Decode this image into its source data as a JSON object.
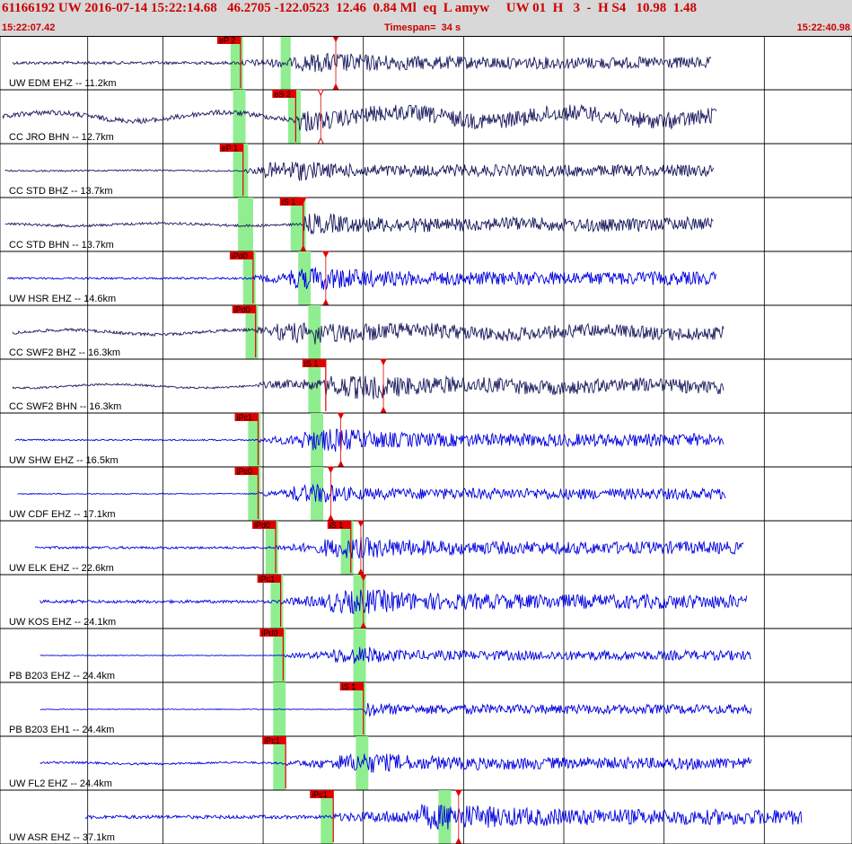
{
  "header": {
    "title": "61166192 UW 2016-07-14 15:22:14.68   46.2705 -122.0523  12.46  0.84 Ml  eq  L amyw     UW 01  H   3  -  H S4   10.98  1.48",
    "time_start": "15:22:07.42",
    "timespan": "Timespan=  34 s",
    "time_end": "15:22:40.98"
  },
  "colors": {
    "header_bg": "#d8d8d8",
    "header_text": "#cc0000",
    "trace_blue": "#0000e0",
    "trace_navy": "#1a1a5e",
    "pick_red": "#e00000",
    "window_green": "#90ee90",
    "gridline": "#000000"
  },
  "chart_data": {
    "type": "seismogram",
    "x_range_s": [
      0,
      34
    ],
    "gridline_seconds": [
      0,
      3.5,
      6.5,
      10.5,
      14.5,
      18.5,
      22.5,
      26.5,
      30.5,
      34
    ],
    "traces": [
      {
        "label": "UW EDM EHZ -- 11.2km",
        "color": "navy_blue",
        "amp": 0.35,
        "noise": 0.06,
        "start": 0.5,
        "end": 28.4,
        "arrival": 9.6,
        "peak": 13.5,
        "decay": 7,
        "wobble": 0,
        "green": [
          9.2,
          9.7,
          11.2,
          11.6
        ],
        "picks": [
          {
            "label": "eP 2",
            "t": 9.6
          }
        ],
        "markers": [
          {
            "t": 13.4,
            "shape": "tri"
          }
        ]
      },
      {
        "label": "CC JRO BHN -- 12.7km",
        "color": "navy",
        "amp": 0.45,
        "noise": 0.1,
        "start": 0.1,
        "end": 28.6,
        "arrival": 11.8,
        "peak": 11.9,
        "decay": 2,
        "wobble": 0.28,
        "green": [
          9.3,
          9.8,
          11.5,
          12.0
        ],
        "picks": [
          {
            "label": "eS 2",
            "t": 11.8
          }
        ],
        "markers": [
          {
            "t": 12.8,
            "shape": "tri-open"
          }
        ]
      },
      {
        "label": "CC STD BHZ -- 13.7km",
        "color": "navy",
        "amp": 0.4,
        "noise": 0.03,
        "start": 0.2,
        "end": 28.5,
        "arrival": 9.7,
        "peak": 12.0,
        "decay": 3,
        "wobble": 0.02,
        "green": [
          9.3,
          9.9
        ],
        "picks": [
          {
            "label": "eP 1",
            "t": 9.7
          }
        ],
        "markers": []
      },
      {
        "label": "CC STD BHN -- 13.7km",
        "color": "navy",
        "amp": 0.42,
        "noise": 0.05,
        "start": 0.2,
        "end": 28.5,
        "arrival": 12.1,
        "peak": 12.2,
        "decay": 6,
        "wobble": 0.08,
        "green": [
          9.5,
          10.1,
          11.6,
          12.2
        ],
        "picks": [
          {
            "label": "iS 1",
            "t": 12.1
          }
        ],
        "markers": [
          {
            "t": 12.1,
            "shape": "tri-b"
          }
        ]
      },
      {
        "label": "UW HSR EHZ -- 14.6km",
        "color": "blue",
        "amp": 0.45,
        "noise": 0.04,
        "start": 0.3,
        "end": 28.6,
        "arrival": 10.1,
        "peak": 13.0,
        "decay": 5,
        "wobble": 0,
        "green": [
          9.7,
          10.2,
          11.9,
          12.4
        ],
        "picks": [
          {
            "label": "iPd0",
            "t": 10.1
          }
        ],
        "markers": [
          {
            "t": 13.0,
            "shape": "tri"
          }
        ]
      },
      {
        "label": "CC SWF2 BHZ -- 16.3km",
        "color": "navy",
        "amp": 0.4,
        "noise": 0.06,
        "start": 0.5,
        "end": 28.9,
        "arrival": 10.2,
        "peak": 12.5,
        "decay": 9,
        "wobble": 0.15,
        "green": [
          9.8,
          10.3,
          12.3,
          12.8
        ],
        "picks": [
          {
            "label": "iPd0",
            "t": 10.2
          }
        ],
        "markers": []
      },
      {
        "label": "CC SWF2 BHN -- 16.3km",
        "color": "navy",
        "amp": 0.45,
        "noise": 0.04,
        "start": 0.5,
        "end": 28.9,
        "arrival": 10.3,
        "peak": 14.5,
        "decay": 9,
        "wobble": 0.12,
        "green": [
          12.3,
          12.8
        ],
        "picks": [
          {
            "label": "iS 1",
            "t": 13.0
          }
        ],
        "markers": [
          {
            "t": 15.3,
            "shape": "tri"
          }
        ]
      },
      {
        "label": "UW SHW EHZ -- 16.5km",
        "color": "blue",
        "amp": 0.45,
        "noise": 0.03,
        "start": 0.6,
        "end": 28.9,
        "arrival": 10.3,
        "peak": 13.5,
        "decay": 5,
        "wobble": 0,
        "green": [
          9.9,
          10.4,
          12.4,
          12.9
        ],
        "picks": [
          {
            "label": "iPc1",
            "t": 10.3
          }
        ],
        "markers": [
          {
            "t": 13.6,
            "shape": "tri"
          }
        ]
      },
      {
        "label": "UW CDF EHZ -- 17.1km",
        "color": "blue",
        "amp": 0.4,
        "noise": 0.02,
        "start": 0.7,
        "end": 29.0,
        "arrival": 10.3,
        "peak": 13.1,
        "decay": 1.2,
        "wobble": 0,
        "green": [
          9.9,
          10.4,
          12.4,
          12.9
        ],
        "picks": [
          {
            "label": "iPc0",
            "t": 10.3
          }
        ],
        "markers": [
          {
            "t": 13.2,
            "shape": "tri"
          }
        ]
      },
      {
        "label": "UW ELK EHZ -- 22.6km",
        "color": "blue",
        "amp": 0.4,
        "noise": 0.05,
        "start": 1.4,
        "end": 29.7,
        "arrival": 11.0,
        "peak": 14.4,
        "decay": 6,
        "wobble": 0,
        "green": [
          10.6,
          11.1,
          13.6,
          14.1
        ],
        "picks": [
          {
            "label": "iPd0",
            "t": 11.0
          },
          {
            "label": "iS 1",
            "t": 14.0
          }
        ],
        "markers": [
          {
            "t": 14.4,
            "shape": "tri"
          }
        ]
      },
      {
        "label": "UW KOS EHZ -- 24.1km",
        "color": "blue",
        "amp": 0.45,
        "noise": 0.06,
        "start": 1.6,
        "end": 29.8,
        "arrival": 11.2,
        "peak": 14.6,
        "decay": 6,
        "wobble": 0,
        "green": [
          10.8,
          11.3,
          14.1,
          14.6
        ],
        "picks": [
          {
            "label": "iPc1",
            "t": 11.2
          }
        ],
        "markers": [
          {
            "t": 14.5,
            "shape": "tri"
          }
        ]
      },
      {
        "label": "PB B203 EHZ -- 24.4km",
        "color": "blue",
        "amp": 0.35,
        "noise": 0.015,
        "start": 1.6,
        "end": 30.0,
        "arrival": 11.3,
        "peak": 14.7,
        "decay": 2,
        "wobble": 0,
        "green": [
          10.9,
          11.4,
          14.1,
          14.6
        ],
        "picks": [
          {
            "label": "iPd0",
            "t": 11.3
          }
        ],
        "markers": []
      },
      {
        "label": "PB B203 EH1 -- 24.4km",
        "color": "blue",
        "amp": 0.35,
        "noise": 0.015,
        "start": 1.6,
        "end": 30.0,
        "arrival": 14.5,
        "peak": 14.6,
        "decay": 1.5,
        "wobble": 0,
        "green": [
          10.9,
          11.4,
          14.1,
          14.6
        ],
        "picks": [
          {
            "label": "iS 1",
            "t": 14.5
          }
        ],
        "markers": []
      },
      {
        "label": "UW FL2 EHZ -- 24.4km",
        "color": "blue",
        "amp": 0.38,
        "noise": 0.04,
        "start": 1.6,
        "end": 30.0,
        "arrival": 11.4,
        "peak": 14.8,
        "decay": 5,
        "wobble": 0.05,
        "green": [
          10.9,
          11.4,
          14.2,
          14.7
        ],
        "picks": [
          {
            "label": "iPc1",
            "t": 11.4
          }
        ],
        "markers": []
      },
      {
        "label": "UW ASR EHZ -- 37.1km",
        "color": "blue",
        "amp": 0.48,
        "noise": 0.07,
        "start": 3.4,
        "end": 32.0,
        "arrival": 13.3,
        "peak": 18.2,
        "decay": 6,
        "wobble": 0,
        "green": [
          12.8,
          13.3,
          17.5,
          18.0
        ],
        "picks": [
          {
            "label": "iPc1",
            "t": 13.3
          }
        ],
        "markers": [
          {
            "t": 18.3,
            "shape": "tri"
          }
        ]
      }
    ]
  }
}
